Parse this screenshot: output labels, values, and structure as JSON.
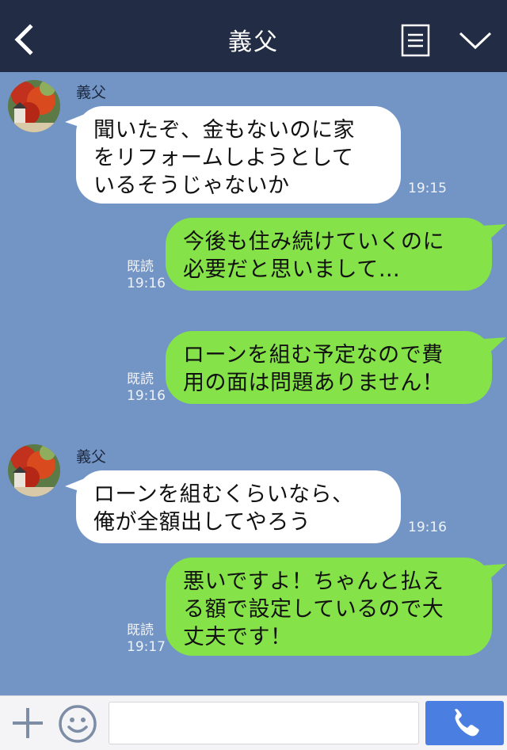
{
  "header": {
    "title": "義父",
    "back_icon": "chevron-left-icon",
    "menu_icon": "list-icon",
    "collapse_icon": "chevron-down-icon"
  },
  "messages": [
    {
      "side": "left",
      "sender": "義父",
      "text": "聞いたぞ、金もないのに家\nをリフォームしようとして\nいるそうじゃないか",
      "time": "19:15"
    },
    {
      "side": "right",
      "read": "既読",
      "text": "今後も住み続けていくのに\n必要だと思いまして…",
      "time": "19:16"
    },
    {
      "side": "right",
      "read": "既読",
      "text": "ローンを組む予定なので費\n用の面は問題ありません！",
      "time": "19:16"
    },
    {
      "side": "left",
      "sender": "義父",
      "text": "ローンを組むくらいなら、\n俺が全額出してやろう",
      "time": "19:16"
    },
    {
      "side": "right",
      "read": "既読",
      "text": "悪いですよ！ちゃんと払え\nる額で設定しているので大\n丈夫です！",
      "time": "19:17"
    }
  ],
  "input": {
    "placeholder": "",
    "plus_icon": "plus-icon",
    "emoji_icon": "smiley-icon",
    "call_icon": "phone-icon"
  },
  "colors": {
    "header_bg": "#232c45",
    "chat_bg": "#7395c5",
    "left_bubble": "#ffffff",
    "right_bubble": "#85e249",
    "call_button": "#4a7ee0"
  }
}
